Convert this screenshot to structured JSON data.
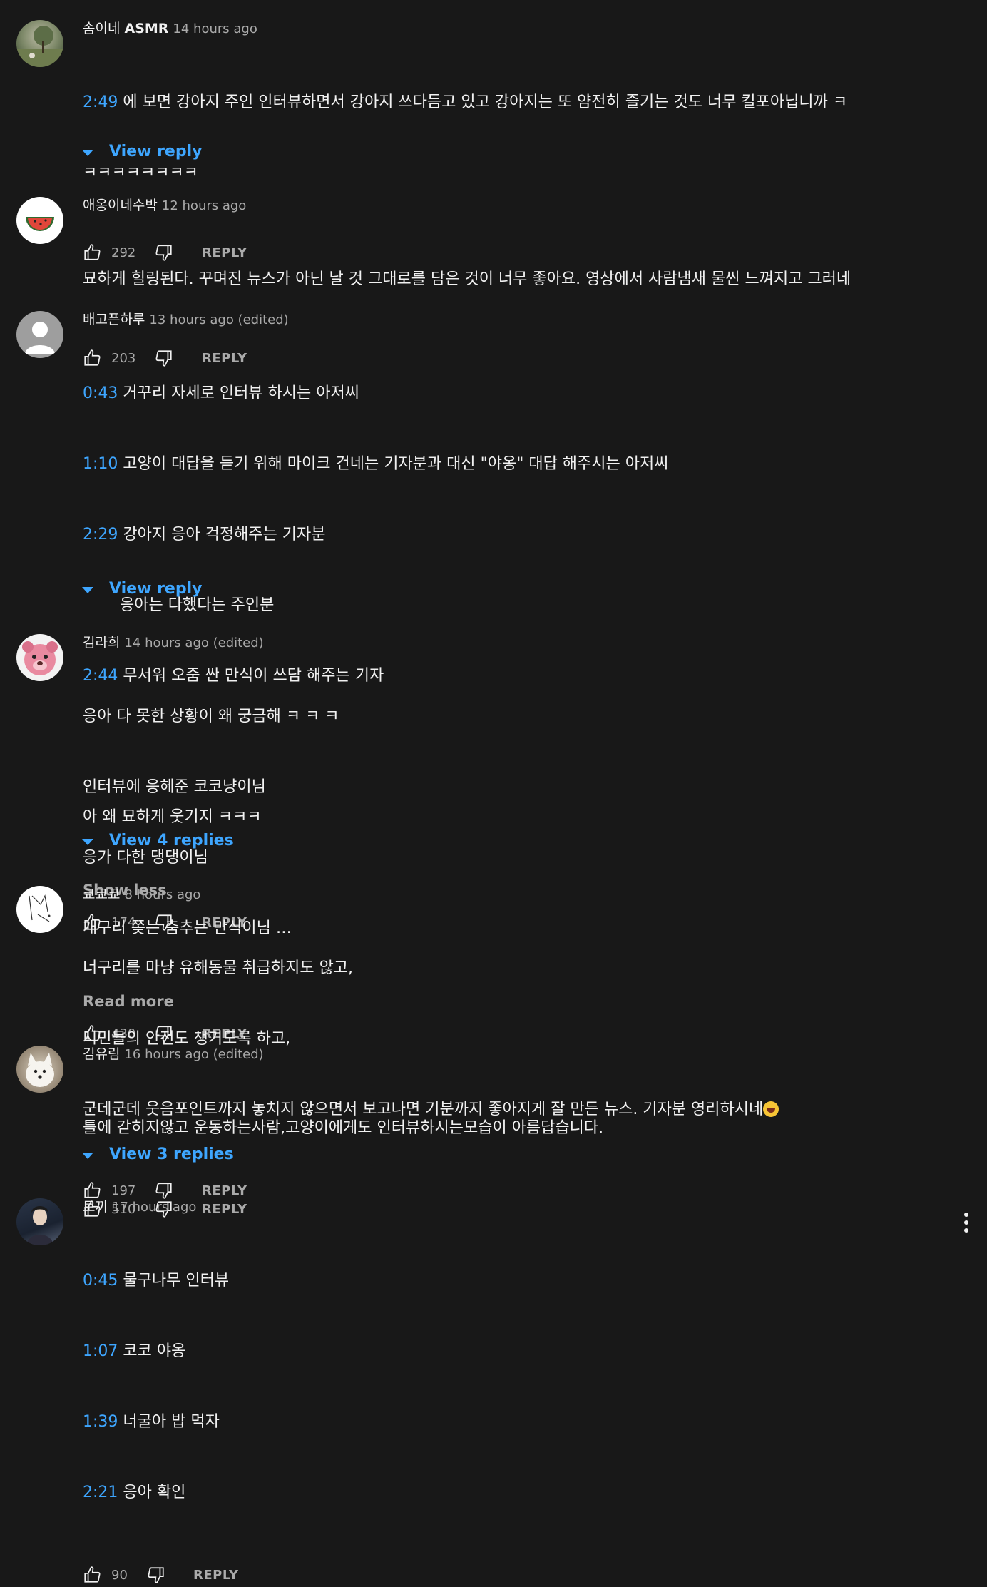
{
  "action_labels": {
    "reply": "REPLY"
  },
  "comments": [
    {
      "author": "솜이네 ASMR",
      "time": "14 hours ago",
      "lines": [
        {
          "ts": "2:49",
          "text": " 에 보면 강아지 주인 인터뷰하면서 강아지 쓰다듬고 있고 강아지는 또 얌전히 즐기는 것도 너무 킬포아닙니까 ㅋ"
        },
        {
          "ts": "",
          "text": "ㅋㅋㅋㅋㅋㅋㅋㅋ"
        }
      ],
      "likes": "292",
      "view_replies": "View reply"
    },
    {
      "author": "애옹이네수박",
      "time": "12 hours ago",
      "lines": [
        {
          "ts": "",
          "text": "묘하게 힐링된다. 꾸며진 뉴스가 아닌 날 것 그대로를 담은 것이 너무 좋아요. 영상에서 사람냄새 물씬 느껴지고 그러네"
        }
      ],
      "likes": "203"
    },
    {
      "author": "배고픈하루",
      "time": "13 hours ago (edited)",
      "lines": [
        {
          "ts": "0:43",
          "text": " 거꾸리 자세로 인터뷰 하시는 아저씨"
        },
        {
          "ts": "1:10",
          "text": " 고양이 대답을 듣기 위해 마이크 건네는 기자분과 대신 \"야옹\" 대답 해주시는 아저씨"
        },
        {
          "ts": "2:29",
          "text": " 강아지 응아 걱정해주는 기자분"
        },
        {
          "ts": "",
          "text": "응아는 다했다는 주인분",
          "indent": true
        },
        {
          "ts": "2:44",
          "text": " 무서워 오줌 싼 만식이 쓰담 해주는 기자"
        },
        {
          "ts": "",
          "text": " "
        },
        {
          "ts": "",
          "text": "아 왜 묘하게 웃기지 ㅋㅋㅋ"
        }
      ],
      "more": "Show less",
      "likes": "174",
      "view_replies": "View reply"
    },
    {
      "author": "김라희",
      "time": "14 hours ago (edited)",
      "lines": [
        {
          "ts": "",
          "text": "응아 다 못한 상황이 왜 궁금해 ㅋ ㅋ ㅋ"
        },
        {
          "ts": "",
          "text": "인터뷰에 응헤준 코코냥이님"
        },
        {
          "ts": "",
          "text": "응가 다한 댕댕이님"
        },
        {
          "ts": "",
          "text": "개구리 쫒는 춤추는 만식이님 …"
        }
      ],
      "more": "Read more",
      "likes": "430",
      "view_replies": "View 4 replies"
    },
    {
      "author": "쿄쿄쿄",
      "time": "8 hours ago",
      "lines": [
        {
          "ts": "",
          "text": "너구리를 마냥 유해동물 취급하지도 않고,"
        },
        {
          "ts": "",
          "text": "시민들의 안전도 챙기도록 하고,"
        },
        {
          "ts": "",
          "text": "군데군데 웃음포인트까지 놓치지 않으면서 보고나면 기분까지 좋아지게 잘 만든 뉴스. 기자분 영리하시네",
          "emoji": true
        }
      ],
      "likes": "197"
    },
    {
      "author": "김유림",
      "time": "16 hours ago (edited)",
      "lines": [
        {
          "ts": "",
          "text": "틀에 갇히지않고 운동하는사람,고양이에게도 인터뷰하시는모습이 아름답습니다."
        }
      ],
      "likes": "510",
      "view_replies": "View 3 replies"
    },
    {
      "author": "토끼",
      "time": "17 hours ago",
      "lines": [
        {
          "ts": "0:45",
          "text": " 물구나무 인터뷰"
        },
        {
          "ts": "1:07",
          "text": " 코코 야옹"
        },
        {
          "ts": "1:39",
          "text": " 너굴아 밥 먹자"
        },
        {
          "ts": "2:21",
          "text": " 응아 확인"
        }
      ],
      "likes": "90"
    }
  ]
}
